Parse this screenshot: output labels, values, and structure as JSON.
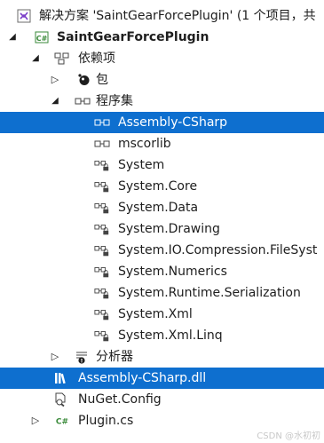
{
  "tree": {
    "solution": "解决方案 'SaintGearForcePlugin' (1 个项目，共",
    "project": "SaintGearForcePlugin",
    "dependencies": "依赖项",
    "packages": "包",
    "assemblies": "程序集",
    "references": [
      "Assembly-CSharp",
      "mscorlib",
      "System",
      "System.Core",
      "System.Data",
      "System.Drawing",
      "System.IO.Compression.FileSyst",
      "System.Numerics",
      "System.Runtime.Serialization",
      "System.Xml",
      "System.Xml.Linq"
    ],
    "analyzers": "分析器",
    "dll_file": "Assembly-CSharp.dll",
    "nuget_file": "NuGet.Config",
    "plugin_file": "Plugin.cs"
  },
  "watermark": "CSDN @水初初"
}
